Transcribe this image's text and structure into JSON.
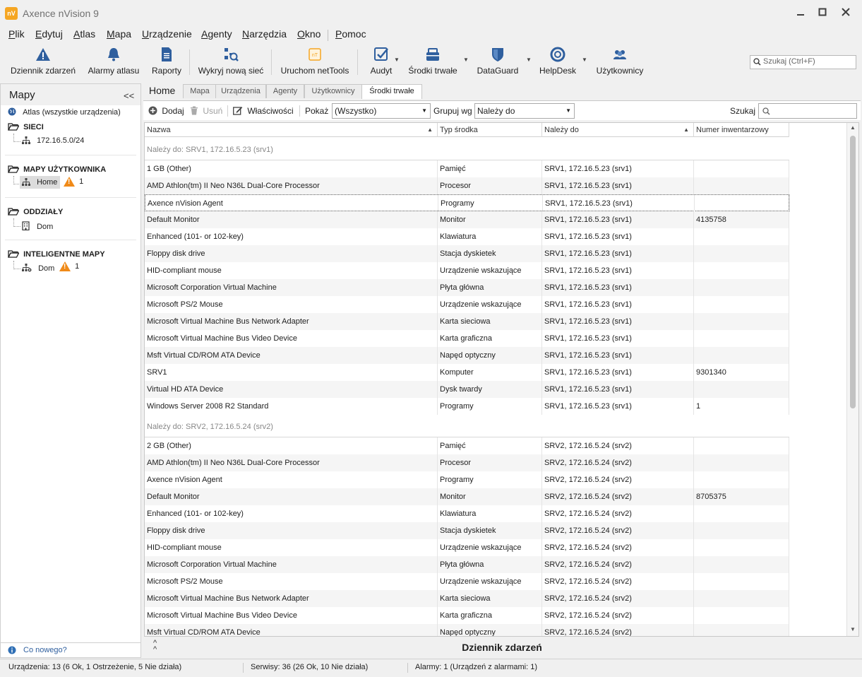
{
  "window": {
    "app_icon_text": "nV",
    "title": "Axence nVision 9"
  },
  "menu": {
    "items": [
      "Plik",
      "Edytuj",
      "Atlas",
      "Mapa",
      "Urządzenie",
      "Agenty",
      "Narzędzia",
      "Okno",
      "Pomoc"
    ]
  },
  "toolbar": {
    "buttons": [
      {
        "label": "Dziennik zdarzeń",
        "icon": "warning-icon"
      },
      {
        "label": "Alarmy atlasu",
        "icon": "bell-icon"
      },
      {
        "label": "Raporty",
        "icon": "report-icon"
      },
      {
        "label": "Wykryj nową sieć",
        "icon": "network-search-icon"
      },
      {
        "label": "Uruchom netTools",
        "icon": "nettools-icon"
      },
      {
        "label": "Audyt",
        "icon": "audit-check-icon"
      },
      {
        "label": "Środki trwałe",
        "icon": "fixed-assets-icon"
      },
      {
        "label": "DataGuard",
        "icon": "shield-icon"
      },
      {
        "label": "HelpDesk",
        "icon": "lifebuoy-icon"
      },
      {
        "label": "Użytkownicy",
        "icon": "users-icon"
      }
    ],
    "search_placeholder": "Szukaj (Ctrl+F)"
  },
  "left_panel": {
    "title": "Mapy",
    "collapse": "<<",
    "atlas": "Atlas (wszystkie urządzenia)",
    "groups": [
      {
        "name": "SIECI",
        "items": [
          {
            "label": "172.16.5.0/24"
          }
        ]
      },
      {
        "name": "MAPY UŻYTKOWNIKA",
        "items": [
          {
            "label": "Home",
            "alarms": "1"
          }
        ]
      },
      {
        "name": "ODDZIAŁY",
        "items": [
          {
            "label": "Dom"
          }
        ]
      },
      {
        "name": "INTELIGENTNE MAPY",
        "items": [
          {
            "label": "Dom",
            "alarms": "1"
          }
        ]
      }
    ],
    "footer": "Co nowego?"
  },
  "tabs": {
    "home": "Home",
    "items": [
      "Mapa",
      "Urządzenia",
      "Agenty",
      "Użytkownicy",
      "Środki trwałe"
    ],
    "active_index": 4
  },
  "actions": {
    "add": "Dodaj",
    "remove": "Usuń",
    "properties": "Właściwości",
    "show_label": "Pokaż",
    "show_value": "(Wszystko)",
    "group_label": "Grupuj wg",
    "group_value": "Należy do",
    "search_label": "Szukaj"
  },
  "grid": {
    "columns": [
      "Nazwa",
      "Typ środka",
      "Należy do",
      "Numer inwentarzowy"
    ],
    "groups": [
      {
        "header": "Należy do: SRV1, 172.16.5.23 (srv1)",
        "rows": [
          [
            "1 GB (Other)",
            "Pamięć",
            "SRV1, 172.16.5.23 (srv1)",
            ""
          ],
          [
            "AMD Athlon(tm) II Neo N36L Dual-Core Processor",
            "Procesor",
            "SRV1, 172.16.5.23 (srv1)",
            ""
          ],
          [
            "Axence nVision Agent",
            "Programy",
            "SRV1, 172.16.5.23 (srv1)",
            ""
          ],
          [
            "Default Monitor",
            "Monitor",
            "SRV1, 172.16.5.23 (srv1)",
            "4135758"
          ],
          [
            "Enhanced (101- or 102-key)",
            "Klawiatura",
            "SRV1, 172.16.5.23 (srv1)",
            ""
          ],
          [
            "Floppy disk drive",
            "Stacja dyskietek",
            "SRV1, 172.16.5.23 (srv1)",
            ""
          ],
          [
            "HID-compliant mouse",
            "Urządzenie wskazujące",
            "SRV1, 172.16.5.23 (srv1)",
            ""
          ],
          [
            "Microsoft Corporation Virtual Machine",
            "Płyta główna",
            "SRV1, 172.16.5.23 (srv1)",
            ""
          ],
          [
            "Microsoft PS/2 Mouse",
            "Urządzenie wskazujące",
            "SRV1, 172.16.5.23 (srv1)",
            ""
          ],
          [
            "Microsoft Virtual Machine Bus Network Adapter",
            "Karta sieciowa",
            "SRV1, 172.16.5.23 (srv1)",
            ""
          ],
          [
            "Microsoft Virtual Machine Bus Video Device",
            "Karta graficzna",
            "SRV1, 172.16.5.23 (srv1)",
            ""
          ],
          [
            "Msft Virtual CD/ROM ATA Device",
            "Napęd optyczny",
            "SRV1, 172.16.5.23 (srv1)",
            ""
          ],
          [
            "SRV1",
            "Komputer",
            "SRV1, 172.16.5.23 (srv1)",
            "9301340"
          ],
          [
            "Virtual HD ATA Device",
            "Dysk twardy",
            "SRV1, 172.16.5.23 (srv1)",
            ""
          ],
          [
            "Windows Server 2008 R2 Standard",
            "Programy",
            "SRV1, 172.16.5.23 (srv1)",
            "1"
          ]
        ]
      },
      {
        "header": "Należy do: SRV2, 172.16.5.24 (srv2)",
        "rows": [
          [
            "2 GB (Other)",
            "Pamięć",
            "SRV2, 172.16.5.24 (srv2)",
            ""
          ],
          [
            "AMD Athlon(tm) II Neo N36L Dual-Core Processor",
            "Procesor",
            "SRV2, 172.16.5.24 (srv2)",
            ""
          ],
          [
            "Axence nVision Agent",
            "Programy",
            "SRV2, 172.16.5.24 (srv2)",
            ""
          ],
          [
            "Default Monitor",
            "Monitor",
            "SRV2, 172.16.5.24 (srv2)",
            "8705375"
          ],
          [
            "Enhanced (101- or 102-key)",
            "Klawiatura",
            "SRV2, 172.16.5.24 (srv2)",
            ""
          ],
          [
            "Floppy disk drive",
            "Stacja dyskietek",
            "SRV2, 172.16.5.24 (srv2)",
            ""
          ],
          [
            "HID-compliant mouse",
            "Urządzenie wskazujące",
            "SRV2, 172.16.5.24 (srv2)",
            ""
          ],
          [
            "Microsoft Corporation Virtual Machine",
            "Płyta główna",
            "SRV2, 172.16.5.24 (srv2)",
            ""
          ],
          [
            "Microsoft PS/2 Mouse",
            "Urządzenie wskazujące",
            "SRV2, 172.16.5.24 (srv2)",
            ""
          ],
          [
            "Microsoft Virtual Machine Bus Network Adapter",
            "Karta sieciowa",
            "SRV2, 172.16.5.24 (srv2)",
            ""
          ],
          [
            "Microsoft Virtual Machine Bus Video Device",
            "Karta graficzna",
            "SRV2, 172.16.5.24 (srv2)",
            ""
          ],
          [
            "Msft Virtual CD/ROM ATA Device",
            "Napęd optyczny",
            "SRV2, 172.16.5.24 (srv2)",
            ""
          ]
        ]
      }
    ]
  },
  "bottom_panel": {
    "title": "Dziennik zdarzeń"
  },
  "status": {
    "devices": "Urządzenia: 13 (6 Ok, 1 Ostrzeżenie, 5 Nie działa)",
    "services": "Serwisy: 36 (26 Ok, 10 Nie działa)",
    "alarms": "Alarmy: 1 (Urządzeń z alarmami: 1)"
  },
  "colors": {
    "accent": "#2f6fb5",
    "warning": "#f08a18",
    "app_icon": "#f5a623"
  }
}
